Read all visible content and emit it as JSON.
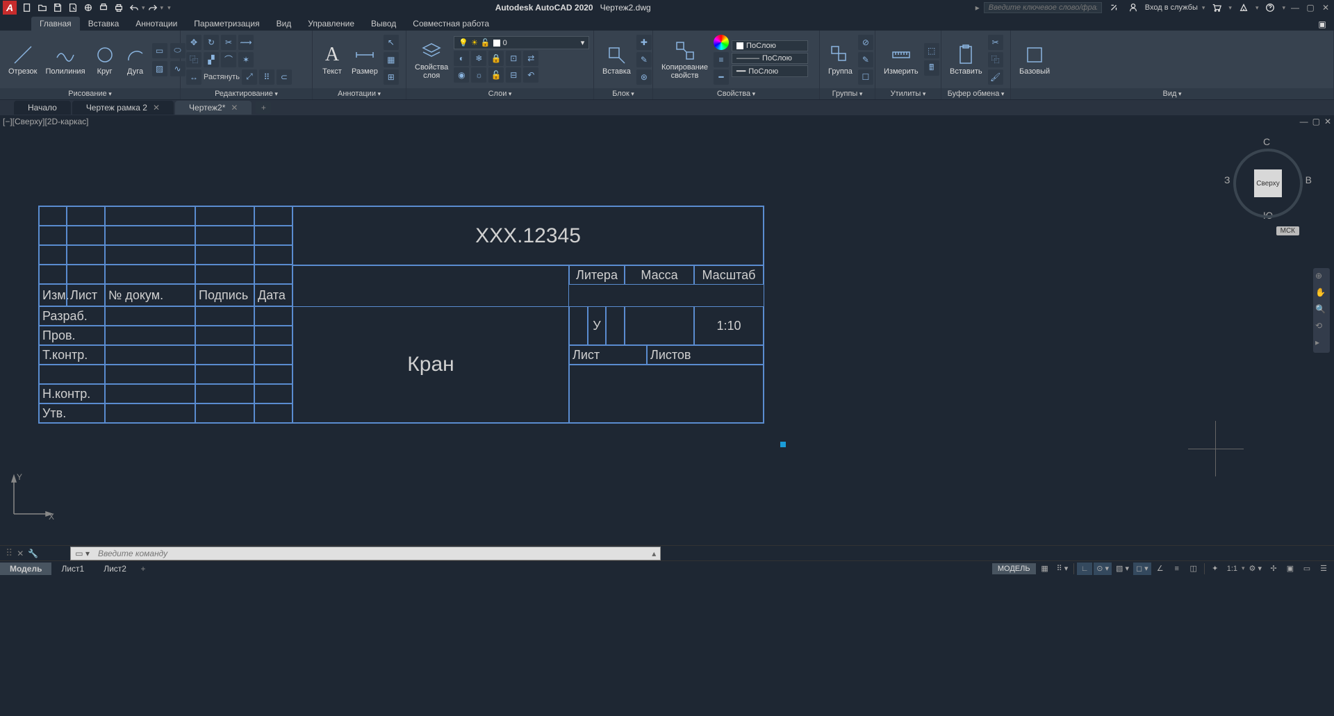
{
  "app": {
    "logo": "A",
    "title": "Autodesk AutoCAD 2020",
    "document": "Чертеж2.dwg"
  },
  "search": {
    "placeholder": "Введите ключевое слово/фразу"
  },
  "login": {
    "label": "Вход в службы"
  },
  "ribbon_tabs": [
    "Главная",
    "Вставка",
    "Аннотации",
    "Параметризация",
    "Вид",
    "Управление",
    "Вывод",
    "Совместная работа"
  ],
  "panels": {
    "draw": {
      "title": "Рисование",
      "line": "Отрезок",
      "polyline": "Полилиния",
      "circle": "Круг",
      "arc": "Дуга"
    },
    "modify": {
      "title": "Редактирование",
      "stretch": "Растянуть"
    },
    "annot": {
      "title": "Аннотации",
      "text": "Текст",
      "dim": "Размер"
    },
    "layers": {
      "title": "Слои",
      "props": "Свойства\nслоя",
      "current": "0"
    },
    "block": {
      "title": "Блок",
      "insert": "Вставка"
    },
    "props": {
      "title": "Свойства",
      "match": "Копирование\nсвойств",
      "bylayer": "ПоСлою"
    },
    "groups": {
      "title": "Группы",
      "group": "Группа"
    },
    "utils": {
      "title": "Утилиты",
      "measure": "Измерить"
    },
    "clipboard": {
      "title": "Буфер обмена",
      "paste": "Вставить"
    },
    "view": {
      "title": "Вид",
      "base": "Базовый"
    }
  },
  "doc_tabs": {
    "start": "Начало",
    "t1": "Чертеж рамка 2",
    "t2": "Чертеж2*"
  },
  "viewport": {
    "label": "[−][Сверху][2D-каркас]"
  },
  "viewcube": {
    "face": "Сверху",
    "n": "С",
    "s": "Ю",
    "e": "В",
    "w": "З",
    "wcs": "МСК"
  },
  "title_block": {
    "doc_number": "XXX.12345",
    "name": "Кран",
    "headers": {
      "izm": "Изм.",
      "list": "Лист",
      "docnum": "№ докум.",
      "sign": "Подпись",
      "date": "Дата",
      "litera": "Литера",
      "mass": "Масса",
      "scale": "Масштаб",
      "sheet": "Лист",
      "sheets": "Листов"
    },
    "roles": {
      "dev": "Разраб.",
      "check": "Пров.",
      "tcontr": "Т.контр.",
      "ncontr": "Н.контр.",
      "approve": "Утв."
    },
    "litera_val": "У",
    "scale_val": "1:10"
  },
  "cmdline": {
    "placeholder": "Введите команду"
  },
  "layout_tabs": {
    "model": "Модель",
    "l1": "Лист1",
    "l2": "Лист2"
  },
  "status": {
    "model": "МОДЕЛЬ",
    "scale": "1:1"
  },
  "ucs": {
    "x": "X",
    "y": "Y"
  }
}
